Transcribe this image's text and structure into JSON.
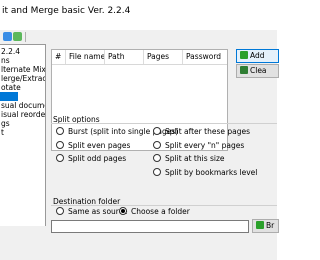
{
  "window": {
    "title": "it and Merge basic Ver. 2.2.4"
  },
  "toolbar": {
    "icons": [
      "save-icon",
      "open-icon"
    ]
  },
  "nav": {
    "items": [
      {
        "label": "2.2.4",
        "selected": false
      },
      {
        "label": "ns",
        "selected": false
      },
      {
        "label": "lternate Mix",
        "selected": false
      },
      {
        "label": "lerge/Extract",
        "selected": false
      },
      {
        "label": "otate",
        "selected": false
      },
      {
        "label": "",
        "selected": true
      },
      {
        "label": "sual document",
        "selected": false
      },
      {
        "label": "isual reorder",
        "selected": false
      },
      {
        "label": "gs",
        "selected": false
      },
      {
        "label": "t",
        "selected": false
      }
    ]
  },
  "table": {
    "columns": [
      "#",
      "File name",
      "Path",
      "Pages",
      "Password"
    ]
  },
  "buttons": {
    "add": "Add",
    "clear": "Clea",
    "browse": "Br"
  },
  "split_options": {
    "legend": "Split options",
    "left": [
      {
        "label": "Burst (split into single pages)",
        "checked": false
      },
      {
        "label": "Split even pages",
        "checked": false
      },
      {
        "label": "Split odd pages",
        "checked": false
      }
    ],
    "right": [
      {
        "label": "Split after these pages",
        "checked": false
      },
      {
        "label": "Split every \"n\" pages",
        "checked": false
      },
      {
        "label": "Split at this size",
        "checked": false
      },
      {
        "label": "Split by bookmarks level",
        "checked": false
      }
    ]
  },
  "destination": {
    "legend": "Destination folder",
    "same_as_source": "Same as source",
    "choose_folder": "Choose a folder",
    "selected": "choose_folder",
    "value": ""
  },
  "colors": {
    "selection": "#0078d7",
    "add_icon": "#2aa02a",
    "clear_icon": "#2e7d32",
    "browse_icon": "#2aa02a"
  }
}
